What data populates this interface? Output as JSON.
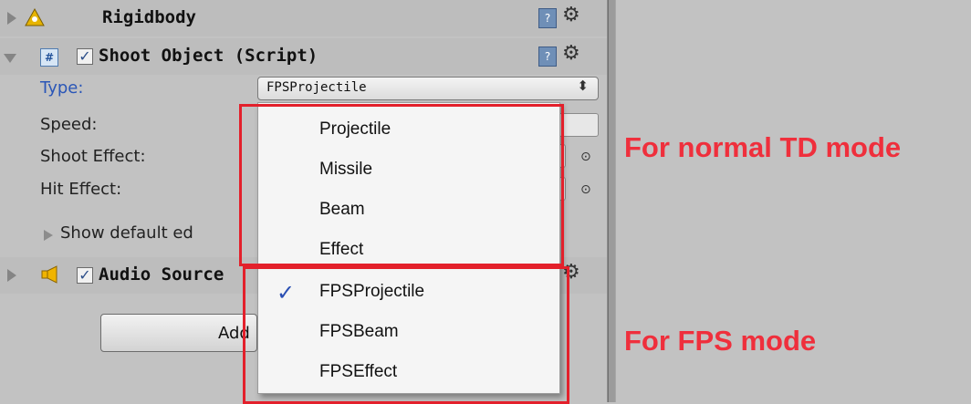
{
  "components": {
    "rigidbody": {
      "title": "Rigidbody"
    },
    "shoot_object": {
      "title": "Shoot Object (Script)",
      "cs_label": "#"
    },
    "audio_source": {
      "title": "Audio Source"
    }
  },
  "fields": {
    "type_label": "Type:",
    "type_value": "FPSProjectile",
    "speed_label": "Speed:",
    "shoot_effect_label": "Shoot Effect:",
    "hit_effect_label": "Hit Effect:",
    "show_default_editor": "Show default ed"
  },
  "add_button_label": "Add",
  "dropdown": {
    "items": [
      "Projectile",
      "Missile",
      "Beam",
      "Effect",
      "FPSProjectile",
      "FPSBeam",
      "FPSEffect"
    ],
    "selected": "FPSProjectile"
  },
  "annotations": {
    "normal": "For normal TD mode",
    "fps": "For FPS mode",
    "color": "#e3202b"
  },
  "icons": {
    "help": "?",
    "gear": "⚙",
    "target": "⊙",
    "select_arrows": "⬍",
    "check": "✓"
  }
}
